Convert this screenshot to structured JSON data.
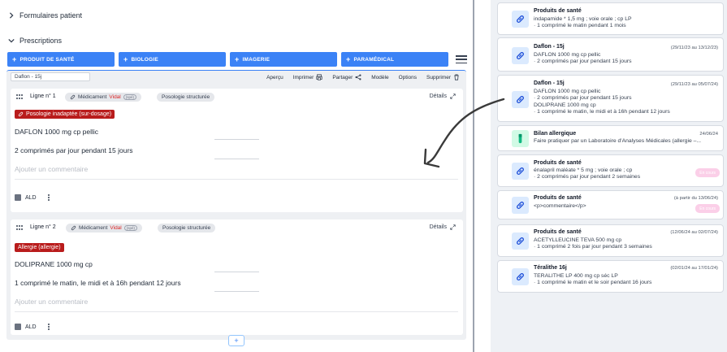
{
  "sections": {
    "formulaires": "Formulaires patient",
    "prescriptions": "Prescriptions"
  },
  "add_buttons": [
    {
      "label": "PRODUIT DE SANTÉ"
    },
    {
      "label": "BIOLOGIE"
    },
    {
      "label": "IMAGERIE"
    },
    {
      "label": "PARAMÉDICAL"
    }
  ],
  "toolbar": {
    "name_value": "Daflon - 15j",
    "apercu": "Aperçu",
    "imprimer": "Imprimer",
    "partager": "Partager",
    "modele": "Modèle",
    "options": "Options",
    "supprimer": "Supprimer"
  },
  "lines": [
    {
      "ligne": "Ligne n° 1",
      "medicament": "Médicament",
      "vidal": "Vidal",
      "spe": "(spé)",
      "posologie": "Posologie structurée",
      "details": "Détails",
      "alert": "Posologie inadaptée (sur-dosage)",
      "drug": "DAFLON 1000 mg cp pellic",
      "dose": "2 comprimés par jour pendant 15 jours",
      "comment_placeholder": "Ajouter un commentaire",
      "ald": "ALD"
    },
    {
      "ligne": "Ligne n° 2",
      "medicament": "Médicament",
      "vidal": "Vidal",
      "spe": "(spé)",
      "posologie": "Posologie structurée",
      "details": "Détails",
      "alert": "Allergie (allergie)",
      "drug": "DOLIPRANE 1000 mg cp",
      "dose": "1 comprimé le matin,  le midi et  à 16h pendant 12 jours",
      "comment_placeholder": "Ajouter un commentaire",
      "ald": "ALD"
    }
  ],
  "add_line": "+",
  "history": [
    {
      "title": "Produits de santé",
      "date": "",
      "lines": [
        "indapamide * 1,5 mg ; voie orale ; cp LP",
        "· 1 comprimé le matin pendant 1 mois"
      ],
      "badge": "",
      "icon": "pill-icon"
    },
    {
      "title": "Daflon - 15j",
      "date": "(29/11/23 au 13/12/23)",
      "lines": [
        "DAFLON 1000 mg cp pellic",
        "· 2 comprimés par jour pendant 15 jours"
      ],
      "badge": "",
      "icon": "pill-icon"
    },
    {
      "title": "Daflon - 15j",
      "date": "(29/11/23 au 05/07/24)",
      "lines": [
        "DAFLON 1000 mg cp pellic",
        "· 2 comprimés par jour pendant 15 jours",
        "DOLIPRANE 1000 mg cp",
        "· 1 comprimé le matin, le midi et à 16h pendant 12 jours"
      ],
      "badge": "",
      "icon": "pill-icon"
    },
    {
      "title": "Bilan allergique",
      "date": "24/06/24",
      "lines": [
        "Faire pratiquer par un Laboratoire d'Analyses Médicales (allergie –..."
      ],
      "badge": "",
      "icon": "test-tube-icon"
    },
    {
      "title": "Produits de santé",
      "date": "",
      "lines": [
        "énalapril maléate * 5 mg ; voie orale ; cp",
        "· 2 comprimés par jour pendant 2 semaines"
      ],
      "badge": "En cours",
      "icon": "pill-icon"
    },
    {
      "title": "Produits de santé",
      "date": "(à partir du 13/06/24)",
      "lines": [
        "<p>commentaire</p>"
      ],
      "badge": "En cours",
      "icon": "pill-icon"
    },
    {
      "title": "Produits de santé",
      "date": "(12/06/24 au 02/07/24)",
      "lines": [
        "ACETYLLEUCINE TEVA 500 mg cp",
        "· 1 comprimé 2 fois par jour pendant 3 semaines"
      ],
      "badge": "",
      "icon": "pill-icon"
    },
    {
      "title": "Téralithe 16j",
      "date": "(02/01/24 au 17/01/24)",
      "lines": [
        "TERALITHE LP 400 mg cp séc LP",
        "· 1 comprimé le matin et le soir pendant 16 jours"
      ],
      "badge": "",
      "icon": "pill-icon"
    }
  ],
  "colors": {
    "primary": "#3b82f6",
    "alert": "#b91c1c",
    "vidal": "#dc2626",
    "badge": "#fbcfe8"
  }
}
